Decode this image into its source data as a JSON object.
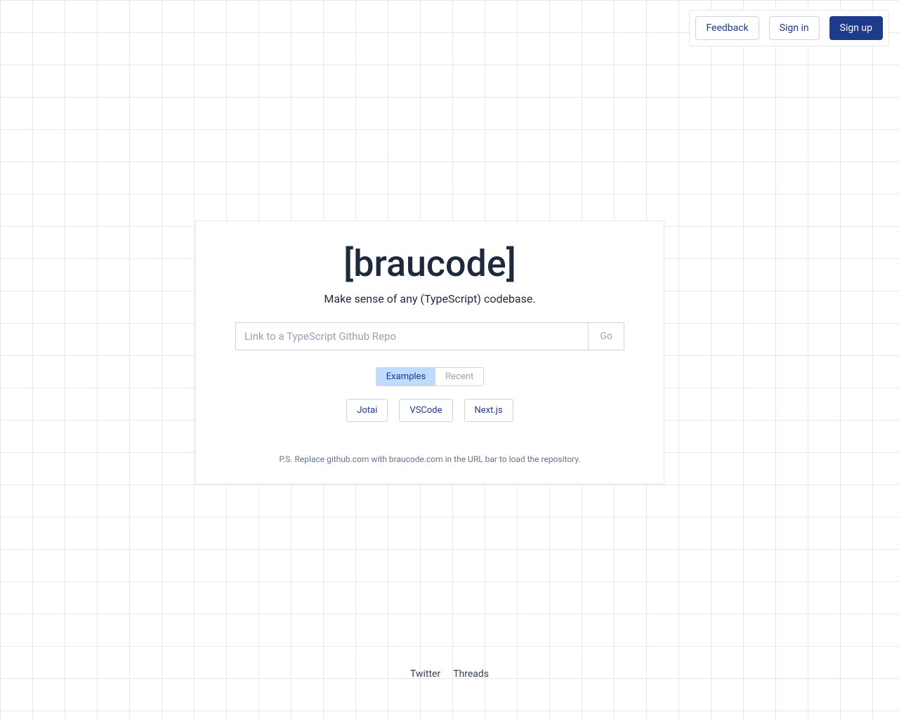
{
  "header": {
    "feedback_label": "Feedback",
    "signin_label": "Sign in",
    "signup_label": "Sign up"
  },
  "main": {
    "logo": "[braucode]",
    "tagline": "Make sense of any (TypeScript) codebase.",
    "input_placeholder": "Link to a TypeScript Github Repo",
    "go_label": "Go",
    "tabs": {
      "examples": "Examples",
      "recent": "Recent"
    },
    "examples": [
      "Jotai",
      "VSCode",
      "Next.js"
    ],
    "ps": "P.S. Replace github.com with braucode.com in the URL bar to load the repository."
  },
  "footer": {
    "twitter": "Twitter",
    "threads": "Threads"
  }
}
